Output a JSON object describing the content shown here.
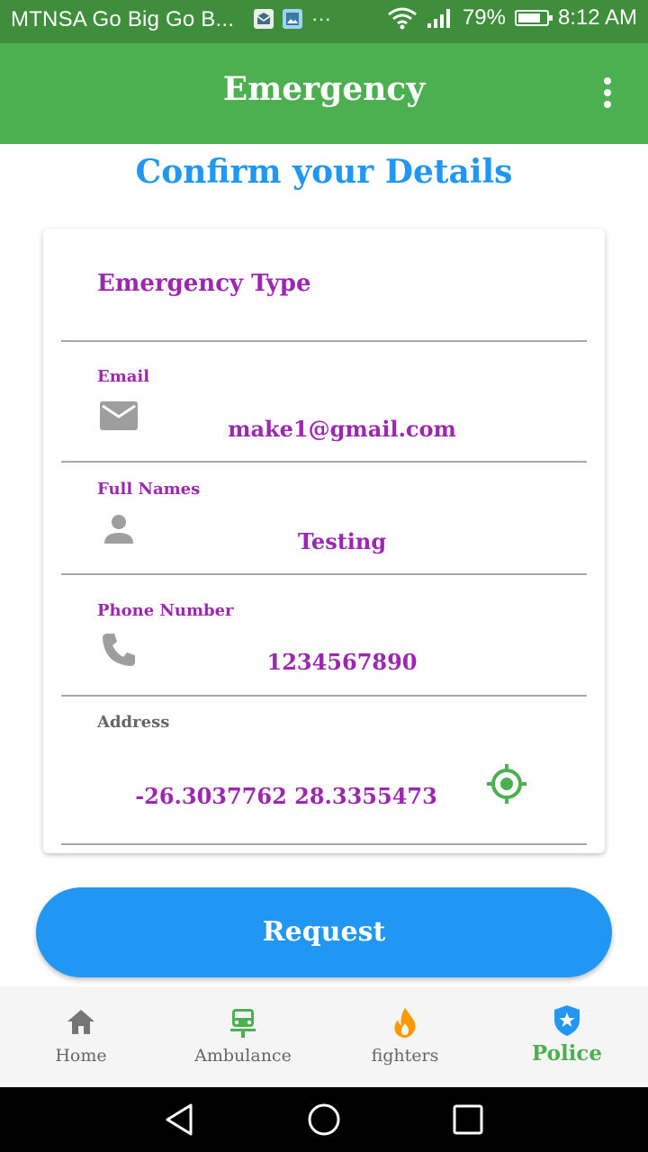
{
  "status_bar": {
    "carrier_text": "MTNSA Go Big Go B...",
    "overflow_dots": "···",
    "battery_percent": "79%",
    "battery_level": 0.79,
    "time": "8:12 AM"
  },
  "app_bar": {
    "title": "Emergency",
    "menu_icon": "more-vert-icon"
  },
  "heading": "Confirm your Details",
  "form": {
    "emergency_type_label": "Emergency Type",
    "email": {
      "label": "Email",
      "value": "make1@gmail.com",
      "icon": "mail-icon"
    },
    "full_names": {
      "label": "Full Names",
      "value": "Testing",
      "icon": "person-icon"
    },
    "phone": {
      "label": "Phone Number",
      "value": "1234567890",
      "icon": "phone-icon"
    },
    "address": {
      "label": "Address",
      "value": "-26.3037762 28.3355473",
      "icon": "my-location-icon"
    }
  },
  "request_button": "Request",
  "bottom_nav": [
    {
      "label": "Home",
      "icon": "home-icon",
      "active": false
    },
    {
      "label": "Ambulance",
      "icon": "ambulance-icon",
      "active": false
    },
    {
      "label": "fighters",
      "icon": "fire-icon",
      "active": false
    },
    {
      "label": "Police",
      "icon": "police-shield-icon",
      "active": true
    }
  ],
  "colors": {
    "status_bar": "#3e8e3c",
    "app_bar": "#4caf50",
    "heading": "#2196f3",
    "field_text": "#9c27b0",
    "button": "#2196f3",
    "active_nav": "#4caf50",
    "fire": "#ff9800"
  }
}
